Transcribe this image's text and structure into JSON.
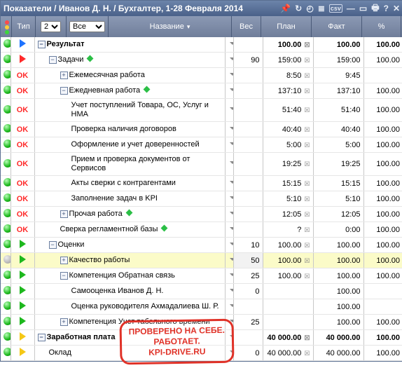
{
  "title": "Показатели / Иванов Д. Н. / Бухгалтер, 1-28 Февраля 2014",
  "toolbar": {
    "type_label": "Тип",
    "level_value": "2",
    "filter_value": "Все",
    "name_label": "Название",
    "weight_label": "Вес",
    "plan_label": "План",
    "fact_label": "Факт",
    "pct_label": "%"
  },
  "rows": [
    {
      "light": "green",
      "type": "tri-blue",
      "indent": 0,
      "exp": "-",
      "name": "Результат",
      "bold": true,
      "weight": "",
      "plan": "100.00",
      "fact": "100.00",
      "pct": "100.00",
      "pbold": true
    },
    {
      "light": "green",
      "type": "tri-red",
      "indent": 1,
      "exp": "-",
      "name": "Задачи",
      "diamond": true,
      "weight": "90",
      "plan": "159:00",
      "fact": "159:00",
      "pct": "100.00"
    },
    {
      "light": "green",
      "type": "ok",
      "indent": 2,
      "exp": "+",
      "name": "Ежемесячная работа",
      "weight": "",
      "plan": "8:50",
      "fact": "9:45",
      "pct": ""
    },
    {
      "light": "green",
      "type": "ok",
      "indent": 2,
      "exp": "-",
      "name": "Ежедневная работа",
      "diamond": true,
      "weight": "",
      "plan": "137:10",
      "fact": "137:10",
      "pct": "100.00"
    },
    {
      "light": "green",
      "type": "ok",
      "indent": 3,
      "exp": "",
      "name": "Учет поступлений Товара, ОС, Услуг и НМА",
      "weight": "",
      "plan": "51:40",
      "fact": "51:40",
      "pct": "100.00"
    },
    {
      "light": "green",
      "type": "ok",
      "indent": 3,
      "exp": "",
      "name": "Проверка наличия договоров",
      "weight": "",
      "plan": "40:40",
      "fact": "40:40",
      "pct": "100.00"
    },
    {
      "light": "green",
      "type": "ok",
      "indent": 3,
      "exp": "",
      "name": "Оформление и учет доверенностей",
      "weight": "",
      "plan": "5:00",
      "fact": "5:00",
      "pct": "100.00"
    },
    {
      "light": "green",
      "type": "ok",
      "indent": 3,
      "exp": "",
      "name": "Прием и проверка документов от Сервисов",
      "weight": "",
      "plan": "19:25",
      "fact": "19:25",
      "pct": "100.00"
    },
    {
      "light": "green",
      "type": "ok",
      "indent": 3,
      "exp": "",
      "name": "Акты сверки с контрагентами",
      "weight": "",
      "plan": "15:15",
      "fact": "15:15",
      "pct": "100.00"
    },
    {
      "light": "green",
      "type": "ok",
      "indent": 3,
      "exp": "",
      "name": "Заполнение задач в KPI",
      "weight": "",
      "plan": "5:10",
      "fact": "5:10",
      "pct": "100.00"
    },
    {
      "light": "green",
      "type": "ok",
      "indent": 2,
      "exp": "+",
      "name": "Прочая работа",
      "diamond": true,
      "weight": "",
      "plan": "12:05",
      "fact": "12:05",
      "pct": "100.00"
    },
    {
      "light": "green",
      "type": "ok",
      "indent": 2,
      "exp": "",
      "name": "Сверка регламентной базы",
      "diamond": true,
      "weight": "",
      "plan": "?",
      "fact": "0:00",
      "pct": "100.00"
    },
    {
      "light": "green",
      "type": "tri-green",
      "indent": 1,
      "exp": "-",
      "name": "Оценки",
      "weight": "10",
      "plan": "100.00",
      "fact": "100.00",
      "pct": "100.00"
    },
    {
      "light": "gray",
      "type": "tri-green",
      "indent": 2,
      "exp": "+",
      "name": "Качество работы",
      "weight": "50",
      "plan": "100.00",
      "fact": "100.00",
      "pct": "100.00",
      "hi": true
    },
    {
      "light": "green",
      "type": "tri-green",
      "indent": 2,
      "exp": "-",
      "name": "Компетенция Обратная связь",
      "weight": "25",
      "plan": "100.00",
      "fact": "100.00",
      "pct": "100.00"
    },
    {
      "light": "green",
      "type": "tri-green",
      "indent": 3,
      "exp": "",
      "name": "Самооценка Иванов Д. Н.",
      "weight": "0",
      "plan": "",
      "fact": "100.00",
      "pct": ""
    },
    {
      "light": "green",
      "type": "tri-green",
      "indent": 3,
      "exp": "",
      "name": "Оценка руководителя Ахмадалиева Ш. Р.",
      "weight": "",
      "plan": "",
      "fact": "100.00",
      "pct": ""
    },
    {
      "light": "green",
      "type": "tri-green",
      "indent": 2,
      "exp": "+",
      "name": "Компетенция Учет табельного времени",
      "weight": "25",
      "plan": "",
      "fact": "100.00",
      "pct": "100.00"
    },
    {
      "light": "green",
      "type": "tri-yellow",
      "indent": 0,
      "exp": "-",
      "name": "Заработная плата",
      "bold": true,
      "weight": "",
      "plan": "40 000.00",
      "fact": "40 000.00",
      "pct": "100.00",
      "pbold": true
    },
    {
      "light": "green",
      "type": "tri-yellow",
      "indent": 1,
      "exp": "",
      "name": "Оклад",
      "weight": "0",
      "plan": "40 000.00",
      "fact": "40 000.00",
      "pct": "100.00"
    }
  ],
  "stamp": {
    "l1": "ПРОВЕРЕНО НА СЕБЕ.",
    "l2": "РАБОТАЕТ.",
    "l3": "KPI-DRIVE.RU"
  }
}
